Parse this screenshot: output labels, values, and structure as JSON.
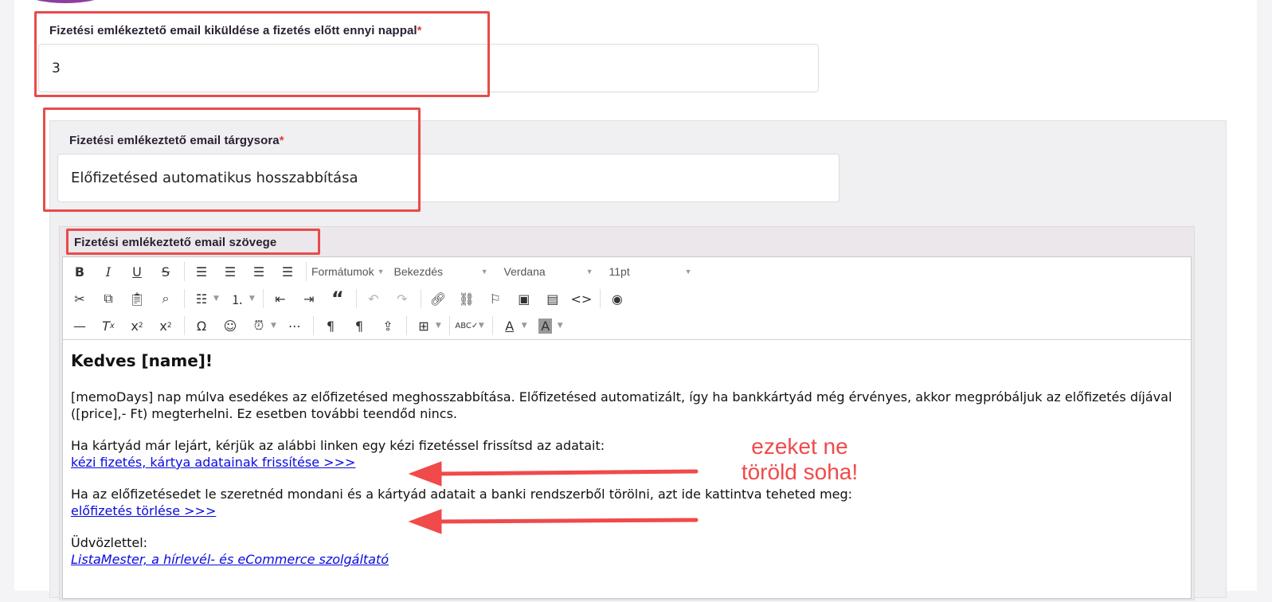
{
  "field_days": {
    "label": "Fizetési emlékeztető email kiküldése a fizetés előtt ennyi nappal",
    "required_mark": "*",
    "value": "3"
  },
  "field_subject": {
    "label": "Fizetési emlékeztető email tárgysora",
    "required_mark": "*",
    "value": "Előfizetésed automatikus hosszabbítása"
  },
  "field_body": {
    "label": "Fizetési emlékeztető email szövege"
  },
  "toolbar": {
    "formats_label": "Formátumok",
    "block_label": "Bekezdés",
    "font_label": "Verdana",
    "size_label": "11pt"
  },
  "email": {
    "greeting": "Kedves [name]!",
    "para1": "[memoDays] nap múlva esedékes az előfizetésed meghosszabbítása. Előfizetésed automatizált, így ha bankkártyád még érvényes, akkor megpróbáljuk az előfizetés díjával ([price],- Ft) megterhelni. Ez esetben további teendőd nincs.",
    "para2": "Ha kártyád már lejárt, kérjük az alábbi linken egy kézi fizetéssel frissítsd az adatait:",
    "link1": "kézi fizetés, kártya adatainak frissítése >>>",
    "para3": "Ha az előfizetésedet le szeretnéd mondani és a kártyád adatait a banki rendszerből törölni, azt ide kattintva teheted meg:",
    "link2": "előfizetés törlése >>>",
    "closing": "Üdvözlettel:",
    "signature": "ListaMester, a hírlevél- és eCommerce szolgáltató"
  },
  "annotation": {
    "line1": "ezeket ne",
    "line2": "töröld soha!",
    "color": "#f04a4a"
  },
  "colors": {
    "highlight": "#e84b4b",
    "link": "#0a0ae0",
    "required": "#e53935"
  }
}
